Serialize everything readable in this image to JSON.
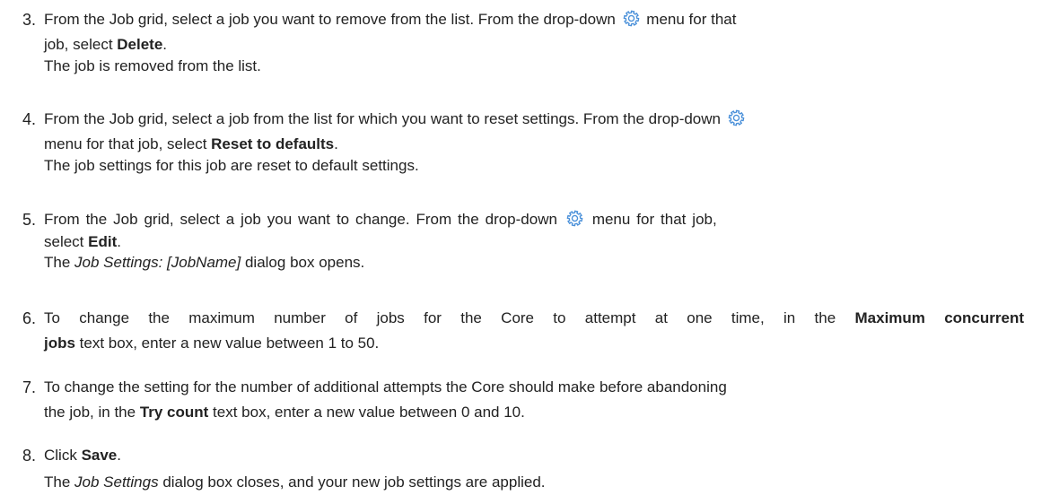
{
  "steps": [
    {
      "number": "3.",
      "lines": [
        {
          "a": "From the Job grid, select a job you want to remove from the list. From the drop-down",
          "b": "menu for that"
        },
        {
          "a": "job, select ",
          "bold": "Delete",
          "c": "."
        },
        {
          "a": "The job is removed from the list."
        }
      ]
    },
    {
      "number": "4.",
      "lines": [
        {
          "a": "From the Job grid, select a job from the list for which you want to reset settings. From the drop-down"
        },
        {
          "a": "menu for that job, select ",
          "bold": "Reset to defaults",
          "c": "."
        },
        {
          "a": "The job settings for this job are reset to default settings."
        }
      ]
    },
    {
      "number": "5.",
      "lines": [
        {
          "a": "From the Job grid, select a job you want to change. From the drop-down",
          "b": "menu for that job,"
        },
        {
          "a": "select ",
          "bold": "Edit",
          "c": "."
        },
        {
          "a": "The ",
          "italic": "Job Settings: [JobName]",
          "c": " dialog box opens."
        }
      ]
    },
    {
      "number": "6.",
      "lines": [
        {
          "a": "To change the maximum number of jobs for the Core to attempt at one time, in the ",
          "bold": "Maximum concurrent"
        },
        {
          "bold": "jobs",
          "c": " text box, enter a new value between 1 to 50."
        }
      ]
    },
    {
      "number": "7.",
      "lines": [
        {
          "a": "To change the setting for the number of additional attempts the Core should make before abandoning"
        },
        {
          "a": "the job, in the ",
          "bold": "Try count",
          "c": " text box, enter a new value between 0 and 10."
        }
      ]
    },
    {
      "number": "8.",
      "lines": [
        {
          "a": "Click ",
          "bold": "Save",
          "c": "."
        },
        {
          "a": "The ",
          "italic": "Job Settings",
          "c": " dialog box closes, and your new job settings are applied."
        }
      ]
    }
  ],
  "icons": {
    "gear": "gear-icon",
    "gear_color": "#4a90d9"
  }
}
